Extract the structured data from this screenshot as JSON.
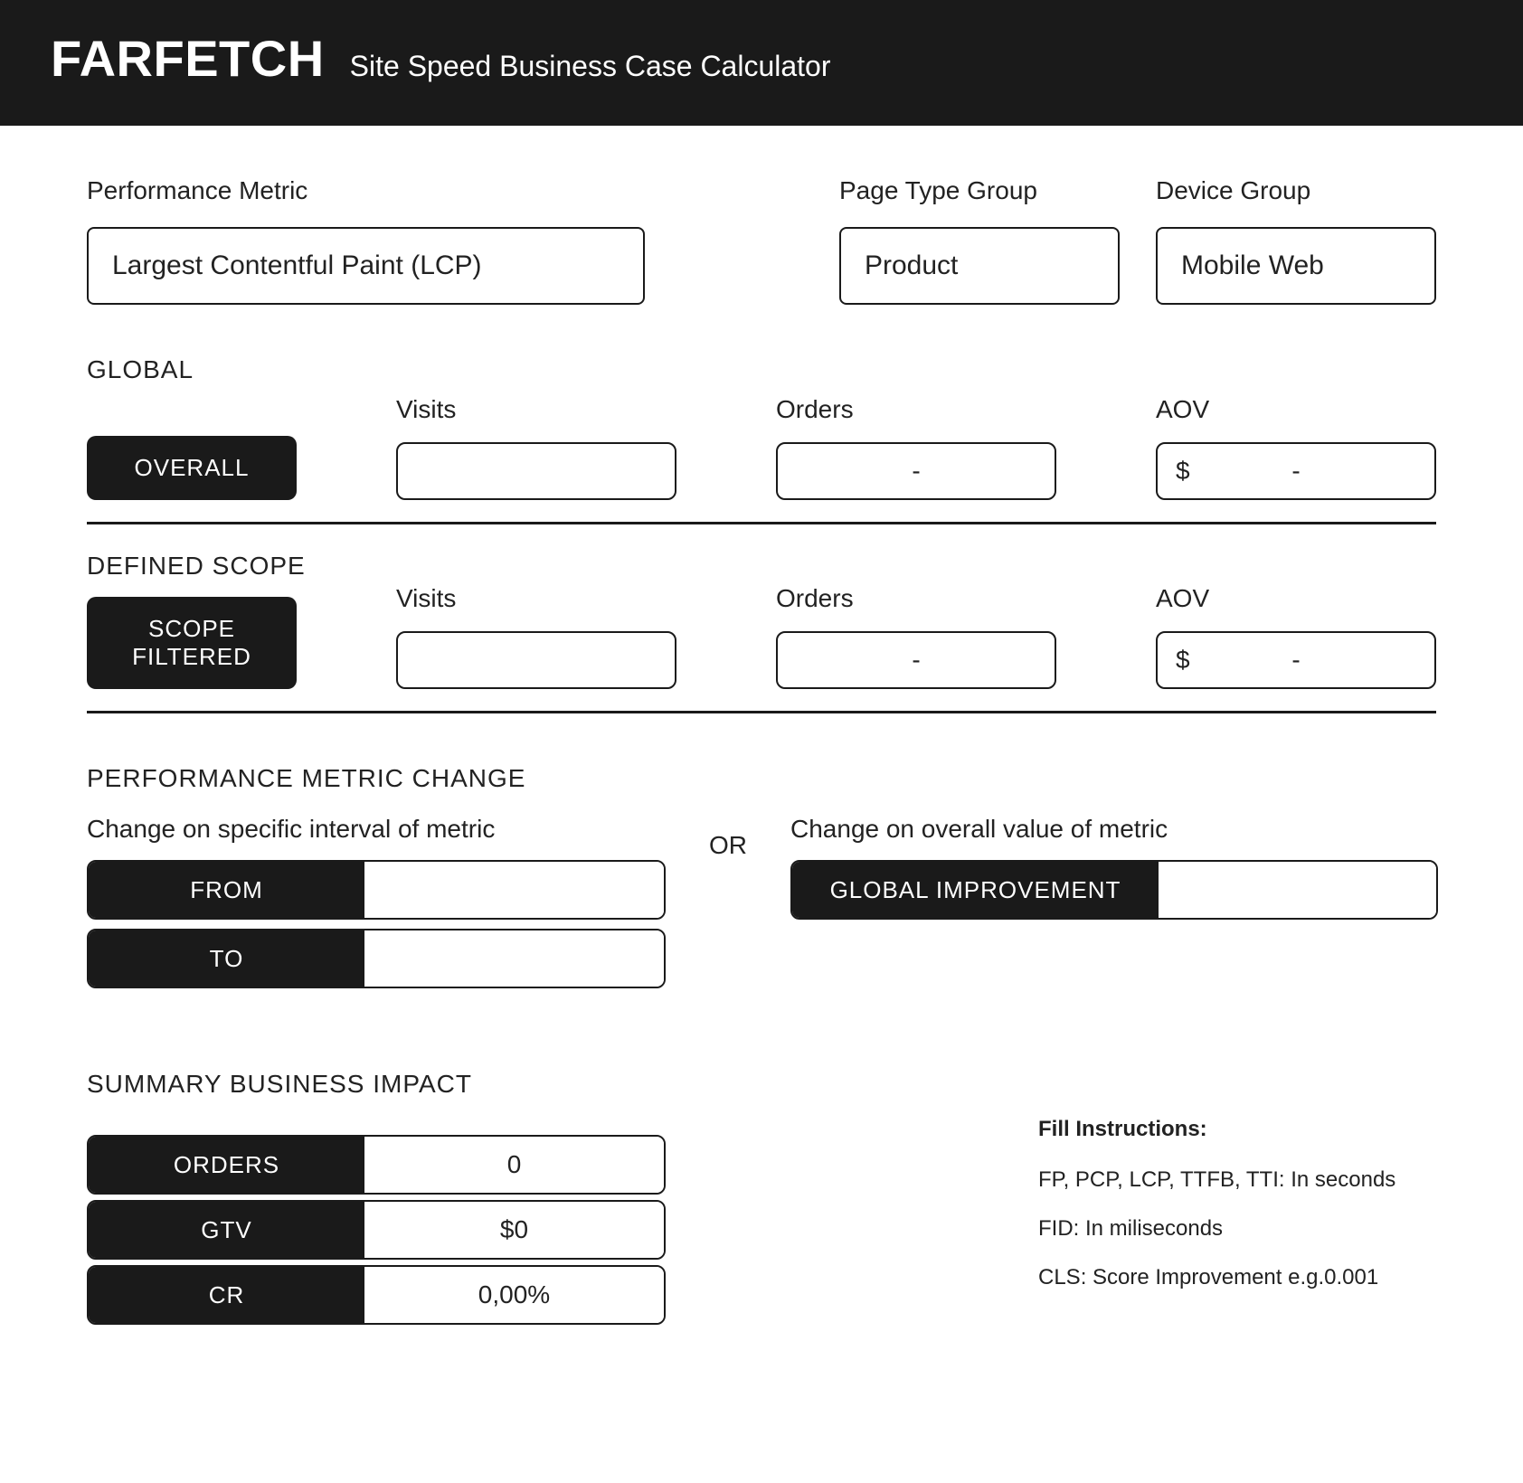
{
  "header": {
    "logo": "FARFETCH",
    "subtitle": "Site Speed Business Case Calculator"
  },
  "filters": {
    "performance_metric": {
      "label": "Performance Metric",
      "value": "Largest Contentful Paint (LCP)"
    },
    "page_type_group": {
      "label": "Page Type Group",
      "value": "Product"
    },
    "device_group": {
      "label": "Device Group",
      "value": "Mobile Web"
    }
  },
  "global": {
    "title": "GLOBAL",
    "pill": "OVERALL",
    "visits": {
      "label": "Visits",
      "value": ""
    },
    "orders": {
      "label": "Orders",
      "value": "-"
    },
    "aov": {
      "label": "AOV",
      "prefix": "$",
      "value": "-"
    }
  },
  "scope": {
    "title": "DEFINED SCOPE",
    "pill": "SCOPE FILTERED",
    "visits": {
      "label": "Visits",
      "value": ""
    },
    "orders": {
      "label": "Orders",
      "value": "-"
    },
    "aov": {
      "label": "AOV",
      "prefix": "$",
      "value": "-"
    }
  },
  "change": {
    "title": "PERFORMANCE METRIC CHANGE",
    "interval_label": "Change on specific interval of metric",
    "from_label": "FROM",
    "from_value": "",
    "to_label": "TO",
    "to_value": "",
    "or": "OR",
    "overall_label": "Change on overall value of metric",
    "global_improvement_label": "GLOBAL IMPROVEMENT",
    "global_improvement_value": ""
  },
  "summary": {
    "title": "SUMMARY BUSINESS IMPACT",
    "orders": {
      "label": "ORDERS",
      "value": "0"
    },
    "gtv": {
      "label": "GTV",
      "value": "$0"
    },
    "cr": {
      "label": "CR",
      "value": "0,00%"
    }
  },
  "instructions": {
    "title": "Fill Instructions:",
    "line1": "FP, PCP, LCP, TTFB, TTI: In seconds",
    "line2": "FID: In miliseconds",
    "line3": "CLS: Score Improvement e.g.0.001"
  }
}
